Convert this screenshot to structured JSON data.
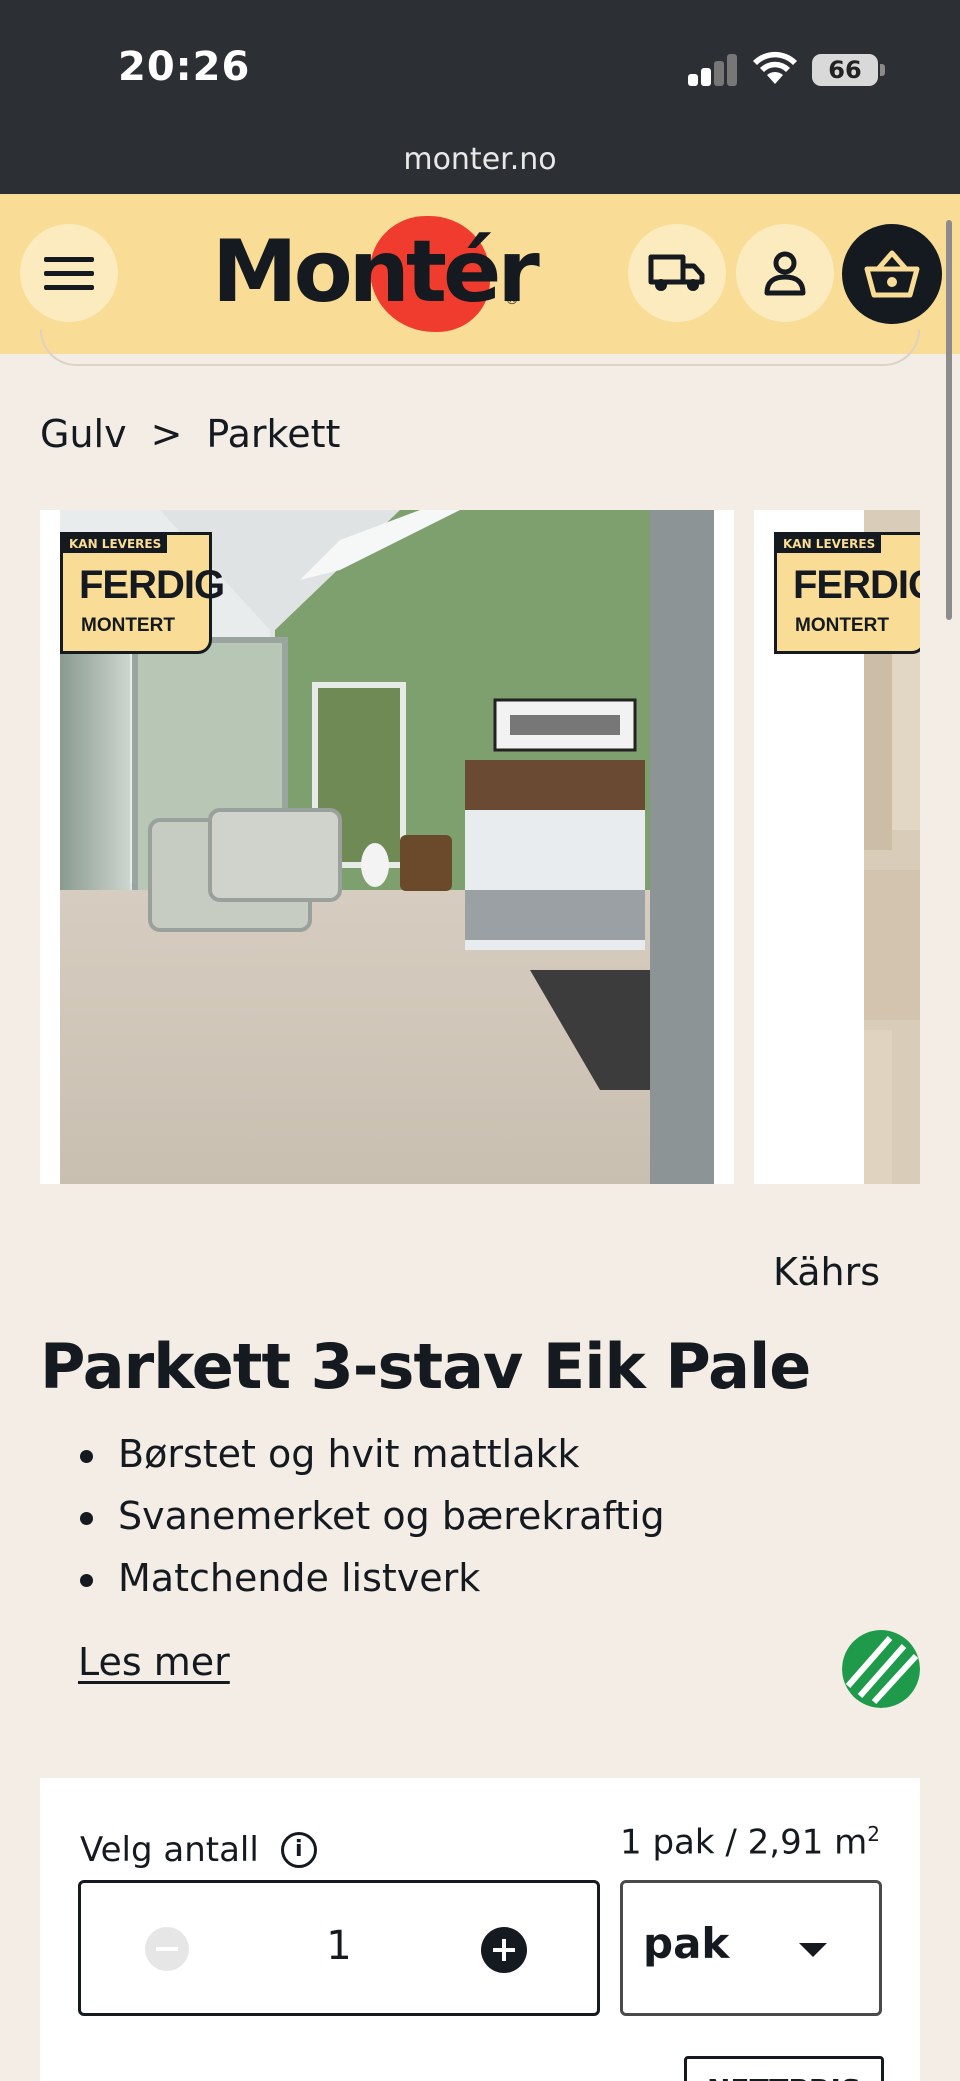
{
  "status_bar": {
    "time": "20:26",
    "battery": "66"
  },
  "browser": {
    "url": "monter.no"
  },
  "header": {
    "logo_text": "Montér",
    "logo_reg": "®"
  },
  "breadcrumb": {
    "items": [
      "Gulv",
      "Parkett"
    ],
    "separator": ">"
  },
  "images": {
    "badge_top": "KAN LEVERES",
    "badge_main": "FERDIG",
    "badge_sub": "MONTERT"
  },
  "product": {
    "brand": "Kährs",
    "title": "Parkett 3-stav Eik Pale",
    "features": [
      "Børstet og hvit mattlakk",
      "Svanemerket og bærekraftig",
      "Matchende listverk"
    ],
    "read_more": "Les mer"
  },
  "quantity": {
    "label": "Velg antall",
    "info_icon": "i",
    "package_info": "1 pak / 2,91 m",
    "package_unit_exp": "2",
    "value": "1",
    "unit": "pak",
    "bottom_badge": "NETTPRIS"
  },
  "colors": {
    "header": "#f9dc95",
    "accent_red": "#ef3c2f",
    "dark": "#141a1f",
    "bg": "#f3ede6"
  }
}
